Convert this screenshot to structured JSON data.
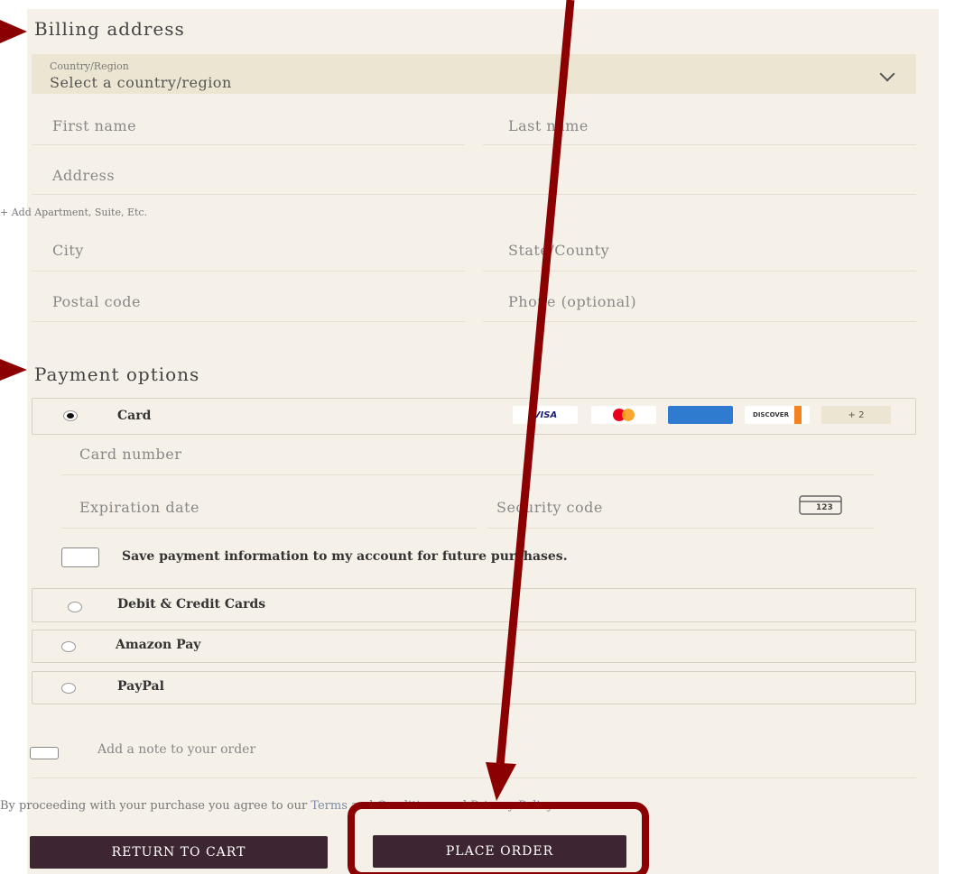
{
  "billing": {
    "title": "Billing address",
    "country_label": "Country/Region",
    "country_value": "Select a country/region",
    "first_name": "First name",
    "last_name": "Last name",
    "address": "Address",
    "add_apartment": "+ Add Apartment, Suite, Etc.",
    "city": "City",
    "state": "State/County",
    "postal": "Postal code",
    "phone": "Phone (optional)"
  },
  "payment": {
    "title": "Payment options",
    "card_label": "Card",
    "card_brands": [
      "VISA",
      "",
      "",
      "DISCOVER",
      "+ 2"
    ],
    "card_number": "Card number",
    "expiration": "Expiration date",
    "security": "Security code",
    "cvc_badge": "123",
    "save_info": "Save payment information to my account for future purchases.",
    "methods": [
      "Debit & Credit Cards",
      "Amazon Pay",
      "PayPal"
    ]
  },
  "note_label": "Add a note to your order",
  "legal": {
    "prefix": "By proceeding with your purchase you agree to our",
    "terms": "Terms and Conditions",
    "and": "and",
    "privacy": "Privacy Policy"
  },
  "buttons": {
    "return_cart": "RETURN TO CART",
    "place_order": "PLACE ORDER"
  },
  "colors": {
    "annotation": "#8b0000",
    "button_bg": "#3e2532",
    "panel_bg": "#f6f1e8",
    "link": "#7a8aa6"
  }
}
